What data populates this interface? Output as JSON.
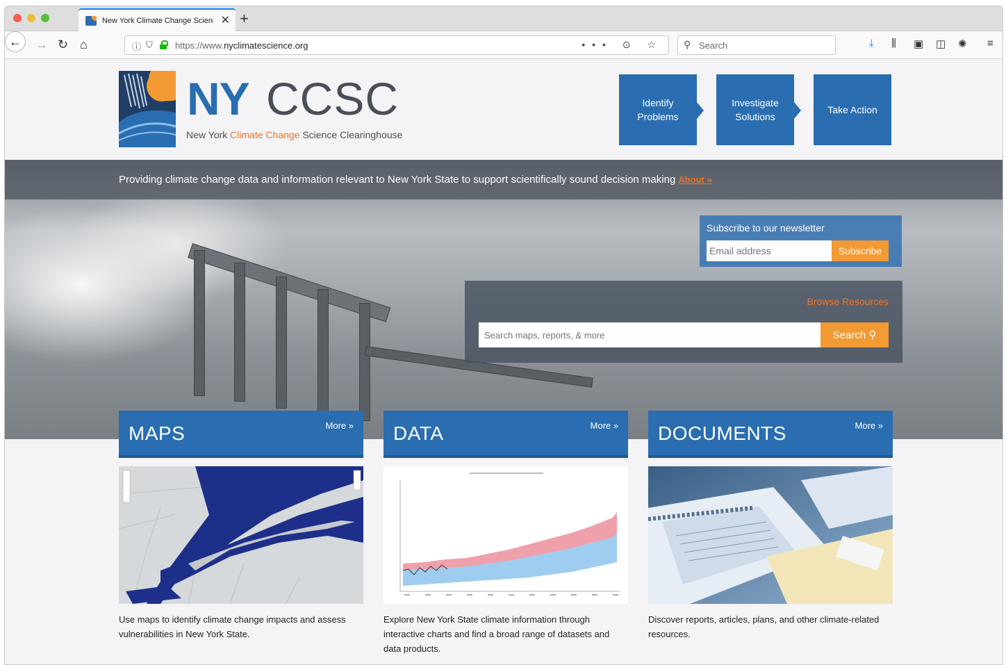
{
  "browser": {
    "tab_title": "New York Climate Change Science Clearinghouse",
    "url_prefix": "https://www.",
    "url_domain": "nyclimatescience.org",
    "search_placeholder": "Search"
  },
  "logo": {
    "ny": "NY",
    "ccsc": "CCSC",
    "sub_a": "New York ",
    "sub_b": "Climate Change",
    "sub_c": " Science Clearinghouse"
  },
  "steps": [
    {
      "label": "Identify Problems"
    },
    {
      "label": "Investigate Solutions"
    },
    {
      "label": "Take Action"
    }
  ],
  "hero": {
    "tagline": "Providing climate change data and information relevant to New York State to support scientifically sound decision making",
    "about_link": "About »"
  },
  "newsletter": {
    "title": "Subscribe to our newsletter",
    "email_placeholder": "Email address",
    "button": "Subscribe"
  },
  "browse": {
    "title": "Browse Resources",
    "placeholder": "Search maps, reports, & more",
    "button": "Search"
  },
  "cards": [
    {
      "title": "MAPS",
      "more": "More »",
      "description": "Use maps to identify climate change impacts and assess vulnerabilities in New York State."
    },
    {
      "title": "DATA",
      "more": "More »",
      "description": "Explore New York State climate information through interactive charts and find a broad range of datasets and data products."
    },
    {
      "title": "DOCUMENTS",
      "more": "More »",
      "description": "Discover reports, articles, plans, and other climate-related resources."
    }
  ],
  "colors": {
    "brand_blue": "#2a6db1",
    "accent_orange": "#f39a34",
    "text_dark": "#4a4e58"
  }
}
